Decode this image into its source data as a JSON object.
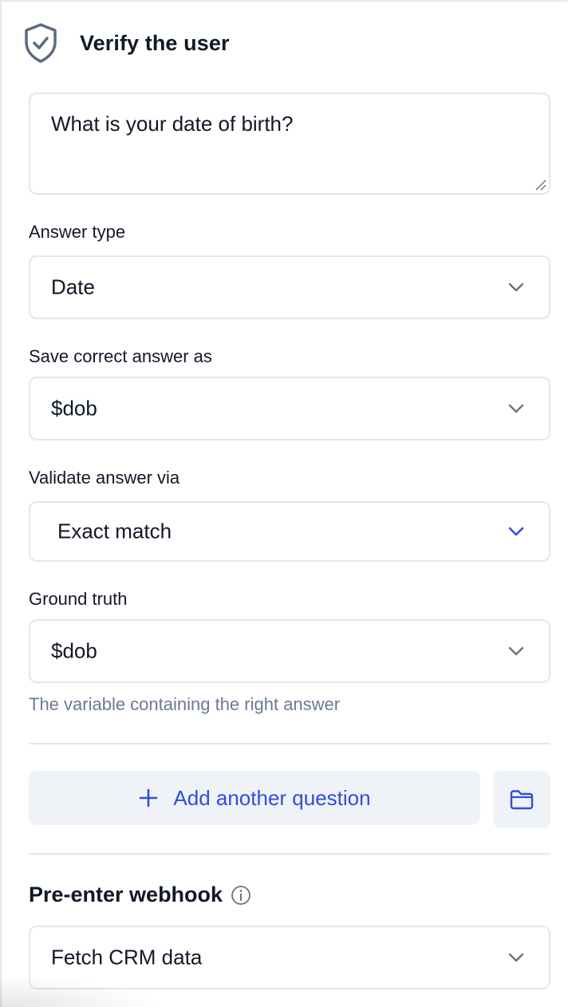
{
  "header": {
    "title": "Verify the user",
    "icon": "shield-check-icon"
  },
  "question": {
    "value": "What is your date of birth?"
  },
  "answer_type": {
    "label": "Answer type",
    "value": "Date"
  },
  "save_answer": {
    "label": "Save correct answer as",
    "value": "$dob"
  },
  "validate": {
    "label": "Validate answer via",
    "value": "Exact match"
  },
  "ground_truth": {
    "label": "Ground truth",
    "value": "$dob",
    "helper": "The variable containing the right answer"
  },
  "actions": {
    "add_question_label": "Add another question"
  },
  "webhook": {
    "title": "Pre-enter webhook",
    "value": "Fetch CRM data"
  },
  "colors": {
    "accent": "#2f4ede",
    "chevron_default": "#6b7280",
    "border": "#e5e7eb",
    "button_bg": "#eff3f8",
    "helper_text": "#6b7a90"
  }
}
